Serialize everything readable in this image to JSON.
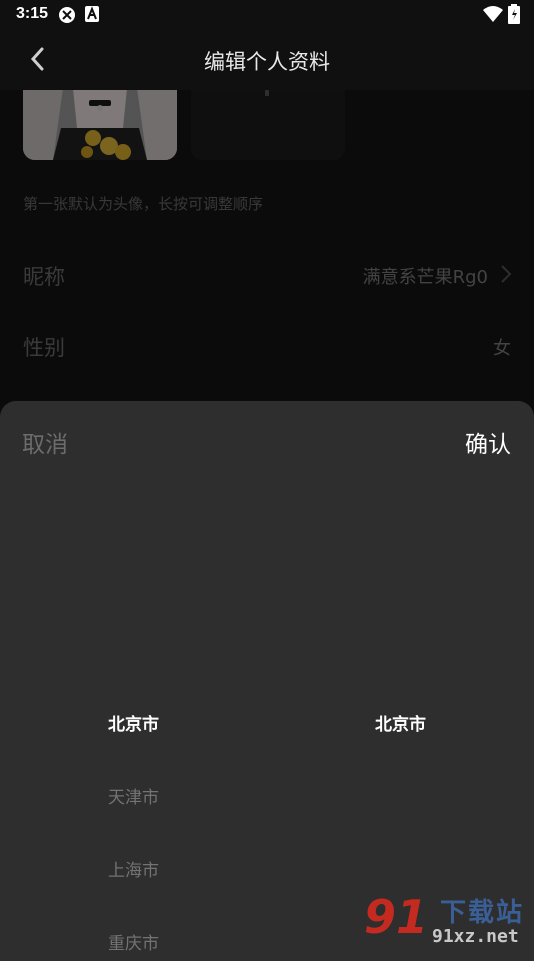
{
  "status_bar": {
    "time": "3:15"
  },
  "header": {
    "title": "编辑个人资料"
  },
  "photos": {
    "hint": "第一张默认为头像，长按可调整顺序"
  },
  "rows": [
    {
      "label": "昵称",
      "value": "满意系芒果Rg0"
    },
    {
      "label": "性别",
      "value": "女"
    }
  ],
  "picker": {
    "cancel_label": "取消",
    "confirm_label": "确认",
    "province_column": [
      "北京市",
      "天津市",
      "上海市",
      "重庆市"
    ],
    "city_column": [
      "北京市"
    ]
  },
  "watermark": {
    "number": "91",
    "text": "下载站",
    "url": "91xz.net"
  },
  "colors": {
    "accent": "#ffffff",
    "sheet_bg": "#2e2e2e",
    "watermark_red": "#c42a1f",
    "watermark_blue": "#3a5f96"
  }
}
